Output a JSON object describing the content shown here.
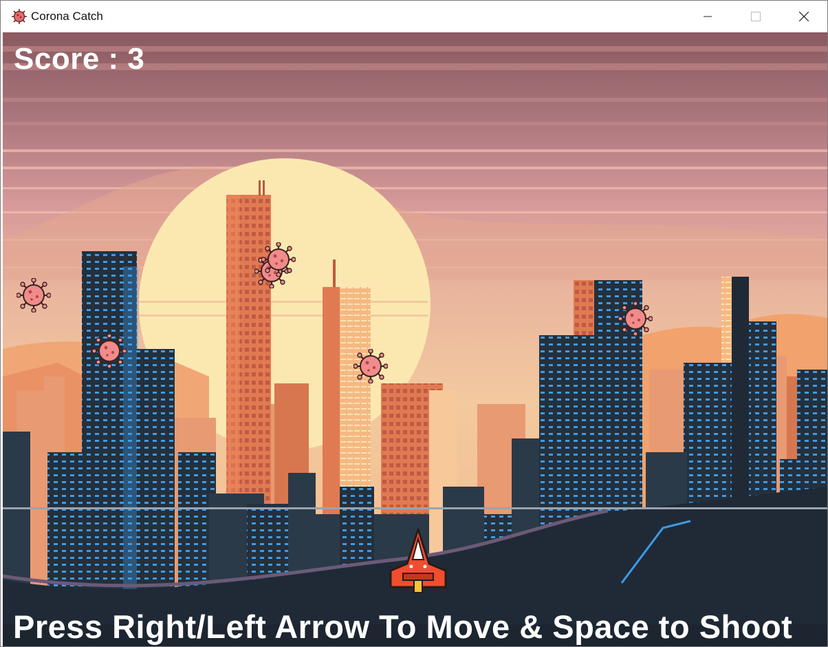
{
  "window": {
    "title": "Corona Catch",
    "app_icon": "virus-icon",
    "controls": [
      "minimize-icon",
      "maximize-icon",
      "close-icon"
    ]
  },
  "game": {
    "score_label": "Score : 3",
    "score": 3,
    "instructions": "Press Right/Left Arrow To Move & Space to Shoot",
    "background": "sunset-city-skyline",
    "sprites": {
      "enemy": "virus-icon",
      "player": "spaceship-icon"
    },
    "colors": {
      "sky_top": "#8b5a60",
      "sun": "#fbe8b0",
      "city_dark": "#1f2a36",
      "window_blue": "#3d9be9",
      "virus": "#f28b8b",
      "ship": "#f04e2e"
    }
  }
}
